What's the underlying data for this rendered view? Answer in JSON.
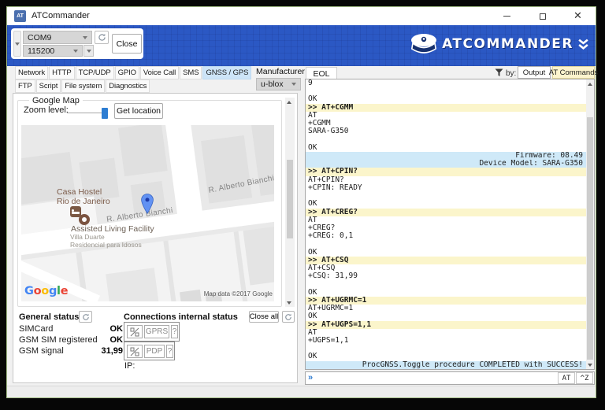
{
  "window": {
    "title": "ATCommander"
  },
  "header": {
    "port_value": "COM9",
    "baud_value": "115200",
    "close_button": "Close",
    "brand": "ATCOMMANDER"
  },
  "tabs": {
    "row1": [
      "Network",
      "HTTP",
      "TCP/UDP",
      "GPIO",
      "Voice Call",
      "SMS",
      "GNSS / GPS"
    ],
    "row1_selected": "GNSS / GPS",
    "row2": [
      "FTP",
      "Script",
      "File system",
      "Diagnostics"
    ]
  },
  "manufacturer": {
    "label": "Manufacturer",
    "value": "u-blox"
  },
  "right_header": {
    "eol_tab": "EOL",
    "by_label": "by:",
    "output_button": "Output",
    "at_commands_button": "AT Commands"
  },
  "map_panel": {
    "group_title": "Google Map",
    "zoom_label": "Zoom level:",
    "get_location_button": "Get location",
    "map": {
      "poi_hostel_line1": "Casa Hostel",
      "poi_hostel_line2": "Rio de Janeiro",
      "poi_facility_line1": "Assisted Living Facility",
      "poi_facility_line2": "Villa Duarte",
      "poi_facility_line3": "Residencial para Idosos",
      "street_label": "R. Alberto Bianchi",
      "street_label_2": "R. Alberto Bianchi",
      "logo_letters": [
        {
          "ch": "G",
          "color": "#4285F4"
        },
        {
          "ch": "o",
          "color": "#EA4335"
        },
        {
          "ch": "o",
          "color": "#FBBC05"
        },
        {
          "ch": "g",
          "color": "#4285F4"
        },
        {
          "ch": "l",
          "color": "#34A853"
        },
        {
          "ch": "e",
          "color": "#EA4335"
        }
      ],
      "attribution": "Map data ©2017 Google"
    }
  },
  "status": {
    "general_title": "General status",
    "rows": [
      {
        "label": "SIMCard",
        "value": "OK"
      },
      {
        "label": "GSM SIM registered",
        "value": "OK"
      },
      {
        "label": "GSM signal",
        "value": "31,99"
      }
    ],
    "connections_title": "Connections internal status",
    "close_all_button": "Close all",
    "gprs_button": "GPRS",
    "gprs_help": "?",
    "pdp_button": "PDP",
    "pdp_help": "?",
    "ip_label": "IP:"
  },
  "terminal": {
    "lines": [
      {
        "text": "9",
        "type": "output"
      },
      {
        "text": "",
        "type": "output"
      },
      {
        "text": "OK",
        "type": "output"
      },
      {
        "text": ">> AT+CGMM",
        "type": "command"
      },
      {
        "text": "AT",
        "type": "output"
      },
      {
        "text": "+CGMM",
        "type": "output"
      },
      {
        "text": "SARA-G350",
        "type": "output"
      },
      {
        "text": "",
        "type": "output"
      },
      {
        "text": "OK",
        "type": "output"
      },
      {
        "text": "Firmware: 08.49",
        "type": "info"
      },
      {
        "text": "Device Model: SARA-G350",
        "type": "info"
      },
      {
        "text": ">> AT+CPIN?",
        "type": "command"
      },
      {
        "text": "AT+CPIN?",
        "type": "output"
      },
      {
        "text": "+CPIN: READY",
        "type": "output"
      },
      {
        "text": "",
        "type": "output"
      },
      {
        "text": "OK",
        "type": "output"
      },
      {
        "text": ">> AT+CREG?",
        "type": "command"
      },
      {
        "text": "AT",
        "type": "output"
      },
      {
        "text": "+CREG?",
        "type": "output"
      },
      {
        "text": "+CREG: 0,1",
        "type": "output"
      },
      {
        "text": "",
        "type": "output"
      },
      {
        "text": "OK",
        "type": "output"
      },
      {
        "text": ">> AT+CSQ",
        "type": "command"
      },
      {
        "text": "AT+CSQ",
        "type": "output"
      },
      {
        "text": "+CSQ: 31,99",
        "type": "output"
      },
      {
        "text": "",
        "type": "output"
      },
      {
        "text": "OK",
        "type": "output"
      },
      {
        "text": ">> AT+UGRMC=1",
        "type": "command"
      },
      {
        "text": "AT+UGRMC=1",
        "type": "output"
      },
      {
        "text": "OK",
        "type": "output"
      },
      {
        "text": ">> AT+UGPS=1,1",
        "type": "command"
      },
      {
        "text": "AT",
        "type": "output"
      },
      {
        "text": "+UGPS=1,1",
        "type": "output"
      },
      {
        "text": "",
        "type": "output"
      },
      {
        "text": "OK",
        "type": "output"
      },
      {
        "text": "ProcGNSS.Toggle procedure COMPLETED with SUCCESS!",
        "type": "info"
      }
    ],
    "at_button": "AT",
    "ctrlz_button": "^Z"
  }
}
